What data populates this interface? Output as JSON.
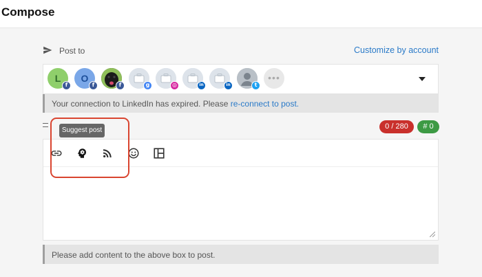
{
  "header": {
    "title": "Compose"
  },
  "post_to": {
    "label": "Post to",
    "customize_link": "Customize by account"
  },
  "accounts": [
    {
      "letter": "L",
      "bg": "#8fcf6b",
      "fg": "#2f6b2a",
      "network": "facebook",
      "badge": "f"
    },
    {
      "letter": "O",
      "bg": "#7aa7e8",
      "fg": "#1d4f9a",
      "network": "facebook",
      "badge": "f"
    },
    {
      "letter": "",
      "bg": "#2a2a2a",
      "fg": "#ffffff",
      "network": "facebook",
      "badge": "f"
    },
    {
      "letter": "",
      "bg": "#dde3ea",
      "fg": "#9aa4ae",
      "network": "google-my-business",
      "badge": "g"
    },
    {
      "letter": "",
      "bg": "#dde3ea",
      "fg": "#9aa4ae",
      "network": "instagram",
      "badge": "◎"
    },
    {
      "letter": "",
      "bg": "#dde3ea",
      "fg": "#9aa4ae",
      "network": "linkedin",
      "badge": "in"
    },
    {
      "letter": "",
      "bg": "#dde3ea",
      "fg": "#9aa4ae",
      "network": "linkedin",
      "badge": "in"
    },
    {
      "letter": "",
      "bg": "#b9c0c7",
      "fg": "#7b848d",
      "network": "twitter",
      "badge": "t"
    }
  ],
  "more_accounts_glyph": "•••",
  "warning": {
    "text": "Your connection to LinkedIn has expired. Please ",
    "link": "re-connect to post."
  },
  "counters": {
    "characters": "0 / 280",
    "hashtags": "# 0"
  },
  "tooltip": "Suggest post",
  "toolbar": {
    "icons": [
      "link-icon",
      "suggest-post-icon",
      "rss-icon",
      "emoji-icon",
      "layout-icon"
    ]
  },
  "info": {
    "text": "Please add content to the above box to post."
  },
  "colors": {
    "link": "#2a7ac8",
    "counter_red": "#c9302c",
    "counter_green": "#3d9a44",
    "highlight": "#d9442f"
  }
}
